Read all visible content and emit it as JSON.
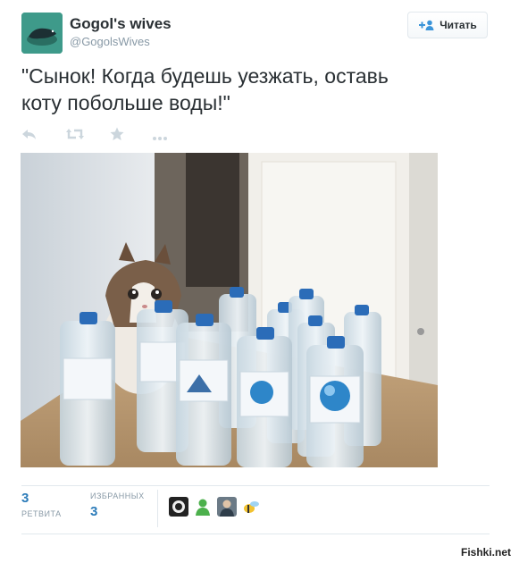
{
  "account": {
    "name": "Gogol's wives",
    "handle": "@GogolsWives",
    "avatar_icon": "seal-icon"
  },
  "follow_button": {
    "label": "Читать",
    "icon": "add-user-icon"
  },
  "tweet": {
    "text": "\"Сынок! Когда будешь уезжать, оставь\nкоту побольше воды!\""
  },
  "actions": [
    {
      "name": "reply-icon"
    },
    {
      "name": "retweet-icon"
    },
    {
      "name": "favorite-icon"
    },
    {
      "name": "more-icon"
    }
  ],
  "photo": {
    "subject": "cat-with-water-bottles"
  },
  "stats": {
    "retweets": {
      "count": "3",
      "label": "РЕТВИТА"
    },
    "favorites": {
      "label": "ИЗБРАННЫХ",
      "count": "3"
    }
  },
  "favoriters": [
    {
      "icon": "favoriter-avatar-1"
    },
    {
      "icon": "favoriter-avatar-2"
    },
    {
      "icon": "favoriter-avatar-3"
    },
    {
      "icon": "favoriter-avatar-4"
    }
  ],
  "watermark": "Fishki.net",
  "colors": {
    "link": "#2b7bb9",
    "muted": "#8899a6",
    "text": "#292f33"
  }
}
